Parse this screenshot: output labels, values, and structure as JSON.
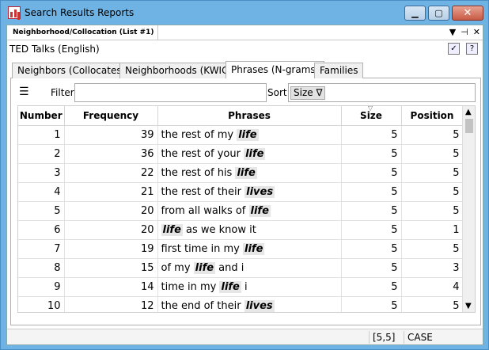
{
  "window": {
    "title": "Search Results Reports"
  },
  "doc_tab": {
    "label": "Neighborhood/Collocation (List #1)"
  },
  "corpus": {
    "label": "TED Talks (English)"
  },
  "tabs": [
    {
      "label": "Neighbors (Collocates)"
    },
    {
      "label": "Neighborhoods (KWIC)"
    },
    {
      "label": "Phrases (N-grams)"
    },
    {
      "label": "Families"
    }
  ],
  "toolbar": {
    "filter_label": "Filter",
    "filter_value": "",
    "sort_label": "Sort",
    "sort_chip": "Size ∇"
  },
  "table": {
    "headers": [
      "Number",
      "Frequency",
      "Phrases",
      "Size",
      "Position"
    ],
    "rows": [
      {
        "number": "1",
        "frequency": "39",
        "pre": "the rest of my ",
        "kw": "life",
        "post": "",
        "size": "5",
        "position": "5"
      },
      {
        "number": "2",
        "frequency": "36",
        "pre": "the rest of your ",
        "kw": "life",
        "post": "",
        "size": "5",
        "position": "5"
      },
      {
        "number": "3",
        "frequency": "22",
        "pre": "the rest of his ",
        "kw": "life",
        "post": "",
        "size": "5",
        "position": "5"
      },
      {
        "number": "4",
        "frequency": "21",
        "pre": "the rest of their ",
        "kw": "lives",
        "post": "",
        "size": "5",
        "position": "5"
      },
      {
        "number": "5",
        "frequency": "20",
        "pre": "from all walks of ",
        "kw": "life",
        "post": "",
        "size": "5",
        "position": "5"
      },
      {
        "number": "6",
        "frequency": "20",
        "pre": "",
        "kw": "life",
        "post": " as we know it",
        "size": "5",
        "position": "1"
      },
      {
        "number": "7",
        "frequency": "19",
        "pre": "first time in my ",
        "kw": "life",
        "post": "",
        "size": "5",
        "position": "5"
      },
      {
        "number": "8",
        "frequency": "15",
        "pre": "of my ",
        "kw": "life",
        "post": " and i",
        "size": "5",
        "position": "3"
      },
      {
        "number": "9",
        "frequency": "14",
        "pre": "time in my ",
        "kw": "life",
        "post": " i",
        "size": "5",
        "position": "4"
      },
      {
        "number": "10",
        "frequency": "12",
        "pre": "the end of their ",
        "kw": "lives",
        "post": "",
        "size": "5",
        "position": "5"
      }
    ]
  },
  "status": {
    "cell1": "[5,5]",
    "cell2": "CASE"
  }
}
